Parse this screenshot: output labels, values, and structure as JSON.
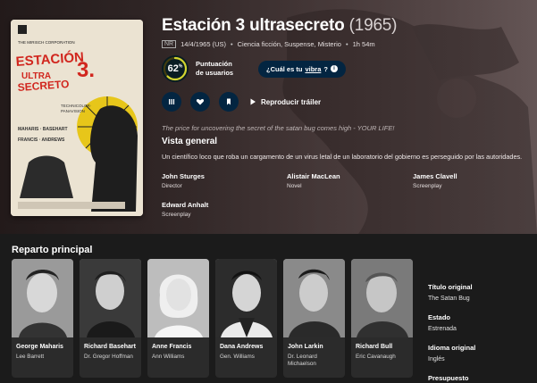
{
  "movie": {
    "title": "Estación 3 ultrasecreto",
    "year": "(1965)",
    "certification": "NR",
    "release": "14/4/1965 (US)",
    "genres": "Ciencia ficción, Suspense, Misterio",
    "runtime": "1h 54m",
    "score": "62",
    "score_percent": 62,
    "score_label": "Puntuación de usuarios",
    "vibe_prefix": "¿Cuál es tu",
    "vibe_word": "vibra",
    "vibe_suffix": "?",
    "play_trailer": "Reproducir tráiler",
    "tagline": "The price for uncovering the secret of the satan bug comes high - YOUR LIFE!",
    "overview_heading": "Vista general",
    "overview": "Un científico loco que roba un cargamento de un virus letal de un laboratorio del gobierno es perseguido por las autoridades."
  },
  "poster": {
    "studio": "THE MIRISCH CORPORATION",
    "title_line1": "ESTACIÓN",
    "title_num": "3.",
    "title_line2": "ULTRA",
    "title_line3": "SECRETO",
    "tech": "TECHNICOLOR · PANAVISION",
    "cast_names": [
      "MAHARIS",
      "BASEHART",
      "FRANCIS",
      "ANDREWS"
    ]
  },
  "crew": [
    {
      "name": "John Sturges",
      "role": "Director"
    },
    {
      "name": "Alistair MacLean",
      "role": "Novel"
    },
    {
      "name": "James Clavell",
      "role": "Screenplay"
    },
    {
      "name": "Edward Anhalt",
      "role": "Screenplay"
    }
  ],
  "cast_heading": "Reparto principal",
  "cast": [
    {
      "name": "George Maharis",
      "character": "Lee Barrett"
    },
    {
      "name": "Richard Basehart",
      "character": "Dr. Gregor Hoffman"
    },
    {
      "name": "Anne Francis",
      "character": "Ann Williams"
    },
    {
      "name": "Dana Andrews",
      "character": "Gen. Williams"
    },
    {
      "name": "John Larkin",
      "character": "Dr. Leonard Michaelson"
    },
    {
      "name": "Richard Bull",
      "character": "Eric Cavanaugh"
    }
  ],
  "facts": {
    "original_title_label": "Título original",
    "original_title": "The Satan Bug",
    "status_label": "Estado",
    "status": "Estrenada",
    "language_label": "Idioma original",
    "language": "Inglés",
    "budget_label": "Presupuesto"
  },
  "colors": {
    "score_ring": "#d2d531",
    "button_bg": "#032541"
  }
}
